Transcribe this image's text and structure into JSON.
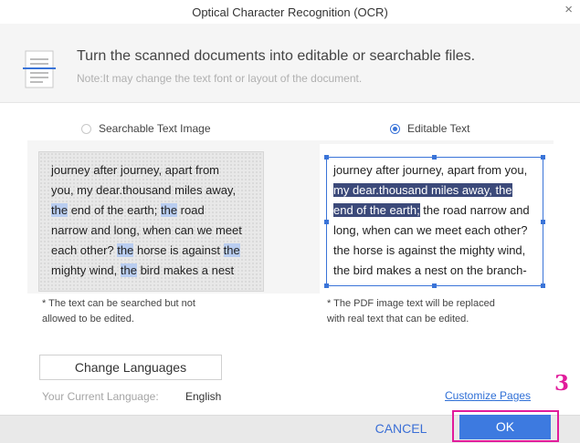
{
  "window": {
    "title": "Optical Character Recognition (OCR)",
    "close_symbol": "×"
  },
  "header": {
    "heading": "Turn the scanned documents into editable or searchable files.",
    "note": "Note:It may change the text font or layout of the document."
  },
  "options": {
    "searchable_label": "Searchable Text Image",
    "editable_label": "Editable Text",
    "selected": "Editable Text"
  },
  "left_preview": {
    "lines": [
      [
        {
          "t": "journey after journey, apart from",
          "s": ""
        }
      ],
      [
        {
          "t": "you, my dear.thousand miles away,",
          "s": ""
        }
      ],
      [
        {
          "t": "the",
          "s": "hl"
        },
        {
          "t": " end of the earth; ",
          "s": ""
        },
        {
          "t": "the",
          "s": "hl"
        },
        {
          "t": " road",
          "s": ""
        }
      ],
      [
        {
          "t": "narrow and long, when can we meet",
          "s": ""
        }
      ],
      [
        {
          "t": "each other? ",
          "s": ""
        },
        {
          "t": "the",
          "s": "hl"
        },
        {
          "t": " horse is against ",
          "s": ""
        },
        {
          "t": "the",
          "s": "hl"
        }
      ],
      [
        {
          "t": "mighty wind, ",
          "s": ""
        },
        {
          "t": "the",
          "s": "hl"
        },
        {
          "t": " bird makes a nest",
          "s": ""
        }
      ]
    ],
    "caption_1": "* The text can be searched but not",
    "caption_2": "allowed to be edited."
  },
  "right_preview": {
    "lines": [
      [
        {
          "t": "journey after journey, apart from you,",
          "s": ""
        }
      ],
      [
        {
          "t": "my dear.thousand miles away, the",
          "s": "sel"
        }
      ],
      [
        {
          "t": "end of the earth;",
          "s": "sel"
        },
        {
          "t": " the road narrow and",
          "s": ""
        }
      ],
      [
        {
          "t": "long, when can we meet each other?",
          "s": ""
        }
      ],
      [
        {
          "t": "the horse is against the mighty wind,",
          "s": ""
        }
      ],
      [
        {
          "t": "the bird makes a nest on the branch-",
          "s": ""
        }
      ]
    ],
    "caption_1": "* The PDF image text will be replaced",
    "caption_2": "with real text that can be edited."
  },
  "language": {
    "button_label": "Change Languages",
    "current_label": "Your Current Language:",
    "current_value": "English",
    "customize_label": "Customize Pages"
  },
  "annotation": {
    "step_number": "3",
    "color": "#e11b9b"
  },
  "footer": {
    "cancel_label": "CANCEL",
    "ok_label": "OK"
  },
  "colors": {
    "accent": "#3d7ae0",
    "selection": "#3c4a7a",
    "search_highlight": "#b9cdf0"
  }
}
